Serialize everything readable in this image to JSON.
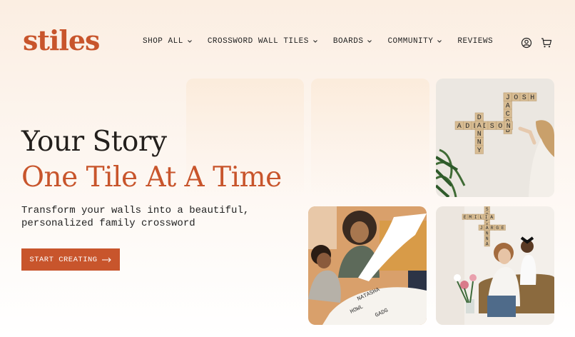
{
  "brand": {
    "logo_text": "stiles",
    "accent": "#c8552c"
  },
  "nav": {
    "items": [
      {
        "label": "SHOP ALL",
        "has_dropdown": true
      },
      {
        "label": "CROSSWORD WALL TILES",
        "has_dropdown": true
      },
      {
        "label": "BOARDS",
        "has_dropdown": true
      },
      {
        "label": "COMMUNITY",
        "has_dropdown": true
      },
      {
        "label": "REVIEWS",
        "has_dropdown": false
      }
    ],
    "icons": [
      "account-icon",
      "cart-icon"
    ]
  },
  "hero": {
    "headline_line1": "Your Story",
    "headline_line2": "One Tile At A Time",
    "subtitle": "Transform your walls into a beautiful, personalized family crossword",
    "cta_label": "START CREATING"
  },
  "gallery": {
    "photo1_words": {
      "across1": "JOSH",
      "across2": "ADDISON",
      "down1": "JACOB",
      "down2": "DANNY"
    },
    "photo2_words": [
      "NATASHA",
      "HOWL",
      "GADG"
    ],
    "photo3_words": {
      "across1": "EMILIA",
      "across2": "JORGE",
      "down1": "SOFIA",
      "down2": "ANNA"
    }
  }
}
